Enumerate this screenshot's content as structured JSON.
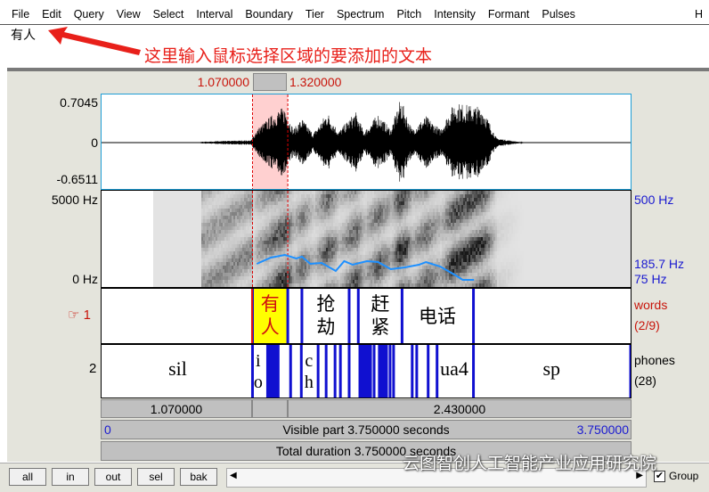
{
  "menu": [
    "File",
    "Edit",
    "Query",
    "View",
    "Select",
    "Interval",
    "Boundary",
    "Tier",
    "Spectrum",
    "Pitch",
    "Intensity",
    "Formant",
    "Pulses",
    "H"
  ],
  "text_field": {
    "value": "有人"
  },
  "annotation": {
    "text": "这里输入鼠标选择区域的要添加的文本",
    "color": "#e8201a"
  },
  "selection": {
    "start_label": "1.070000",
    "end_label": "1.320000",
    "start": 1.07,
    "end": 1.32,
    "color": "#ffd0d0"
  },
  "time_range": {
    "start": 0,
    "end": 3.75
  },
  "waveform": {
    "max_label": "0.7045",
    "zero_label": "0",
    "min_label": "-0.6511"
  },
  "spectrogram": {
    "top_label": "5000 Hz",
    "bottom_label": "0 Hz",
    "pitch_top": "500 Hz",
    "pitch_current": "185.7 Hz",
    "pitch_bottom": "75 Hz",
    "pitch_color": "#1e90ff"
  },
  "tiers": [
    {
      "number": "1",
      "pointer_icon": "hand-pointer",
      "name": "words",
      "count": "(2/9)",
      "color": "#c8140a",
      "boundaries": [
        1.07,
        1.32,
        1.42,
        1.755,
        1.82,
        2.13,
        2.636
      ],
      "labels": [
        {
          "text": "有人",
          "t": 1.195,
          "selected": true
        },
        {
          "text": "抢劫",
          "t": 1.59
        },
        {
          "text": "赶紧",
          "t": 1.975
        },
        {
          "text": "电话",
          "t": 2.38
        }
      ]
    },
    {
      "number": "2",
      "name": "phones",
      "count": "(28)",
      "boundaries": [
        1.07,
        1.177,
        1.19,
        1.202,
        1.215,
        1.227,
        1.24,
        1.252,
        1.34,
        1.416,
        1.535,
        1.592,
        1.655,
        1.693,
        1.755,
        1.831,
        1.844,
        1.856,
        1.869,
        1.881,
        1.894,
        1.907,
        1.932,
        1.969,
        1.982,
        1.995,
        2.008,
        2.02,
        2.045,
        2.07,
        2.202,
        2.234,
        2.315,
        2.378,
        2.636,
        3.75
      ],
      "labels": [
        {
          "text": "sil",
          "t": 0.54
        },
        {
          "text": "i\no",
          "t": 1.11
        },
        {
          "text": "c\nh",
          "t": 1.47
        },
        {
          "text": "ua4",
          "t": 2.5
        },
        {
          "text": "sp",
          "t": 3.19
        }
      ]
    }
  ],
  "bottom_rows": {
    "left_duration": "1.070000",
    "right_duration": "2.430000",
    "visible_start": "0",
    "visible_text": "Visible part 3.750000 seconds",
    "visible_end": "3.750000",
    "total_text": "Total duration 3.750000 seconds"
  },
  "buttons": [
    "all",
    "in",
    "out",
    "sel",
    "bak"
  ],
  "group": {
    "label": "Group",
    "checked": true
  },
  "watermark": "云图智创人工智能产业应用研究院"
}
